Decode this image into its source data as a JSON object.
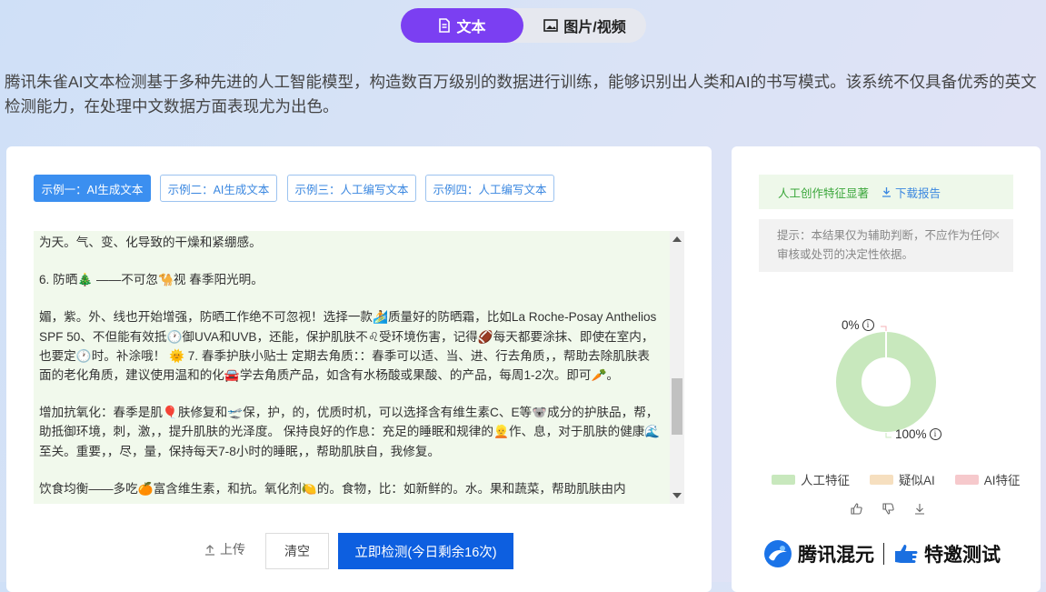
{
  "tabs": {
    "text": "文本",
    "media": "图片/视频"
  },
  "intro": "腾讯朱雀AI文本检测基于多种先进的人工智能模型，构造数百万级别的数据进行训练，能够识别出人类和AI的书写模式。该系统不仅具备优秀的英文检测能力，在处理中文数据方面表现尤为出色。",
  "examples": [
    "示例一：AI生成文本",
    "示例二：AI生成文本",
    "示例三：人工编写文本",
    "示例四：人工编写文本"
  ],
  "text_paragraphs": [
    "为天。气、变、化导致的干燥和紧绷感。",
    "6. 防晒🎄 ——不可忽🐪视 春季阳光明。",
    "媚，紫。外、线也开始增强，防晒工作绝不可忽视！选择一款🏄质量好的防晒霜，比如La Roche-Posay Anthelios SPF 50、不但能有效抵🕐御UVA和UVB，还能，保护肌肤不♌受环境伤害，记得🏈每天都要涂抹、即使在室内，  也要定🕐时。补涂哦！ 🌞 7. 春季护肤小贴士 定期去角质：：春季可以适、当、进、行去角质，，帮助去除肌肤表面的老化角质，建议使用温和的化🚘学去角质产品，如含有水杨酸或果酸、的产品，每周1-2次。即可🥕。",
    "增加抗氧化：春季是肌🎈肤修复和🛫保，护，的，优质时机，可以选择含有维生素C、E等🐨成分的护肤品，帮，助抵御环境，刺，激，，提升肌肤的光泽度。 保持良好的作息：充足的睡眠和规律的👱作、息，对于肌肤的健康🌊至关。重要，，尽，量，保持每天7-8小时的睡眠，，帮助肌肤自，我修复。",
    "饮食均衡——多吃🍊富含维生素，和抗。氧化剂🍋的。食物，比：如新鲜的。水。果和蔬菜，帮助肌肤由内"
  ],
  "buttons": {
    "upload": "上传",
    "clear": "清空",
    "detect": "立即检测(今日剩余16次)"
  },
  "result": {
    "label": "人工创作特征显著",
    "download": "下载报告"
  },
  "hint": "提示：本结果仅为辅助判断，不应作为任何审核或处罚的决定性依据。",
  "donut": {
    "top_label": "0%",
    "bottom_label": "100%",
    "human_fraction": 1.0,
    "ai_fraction": 0.0
  },
  "legend": [
    "人工特征",
    "疑似AI",
    "AI特征"
  ],
  "colors": {
    "human": "#c8e8bd",
    "suspect": "#f6dfbf",
    "ai": "#f6c9cc",
    "accent": "#7b3ff2",
    "primary": "#0d5fe0"
  },
  "brand": {
    "name": "腾讯混元",
    "test": "特邀测试"
  }
}
